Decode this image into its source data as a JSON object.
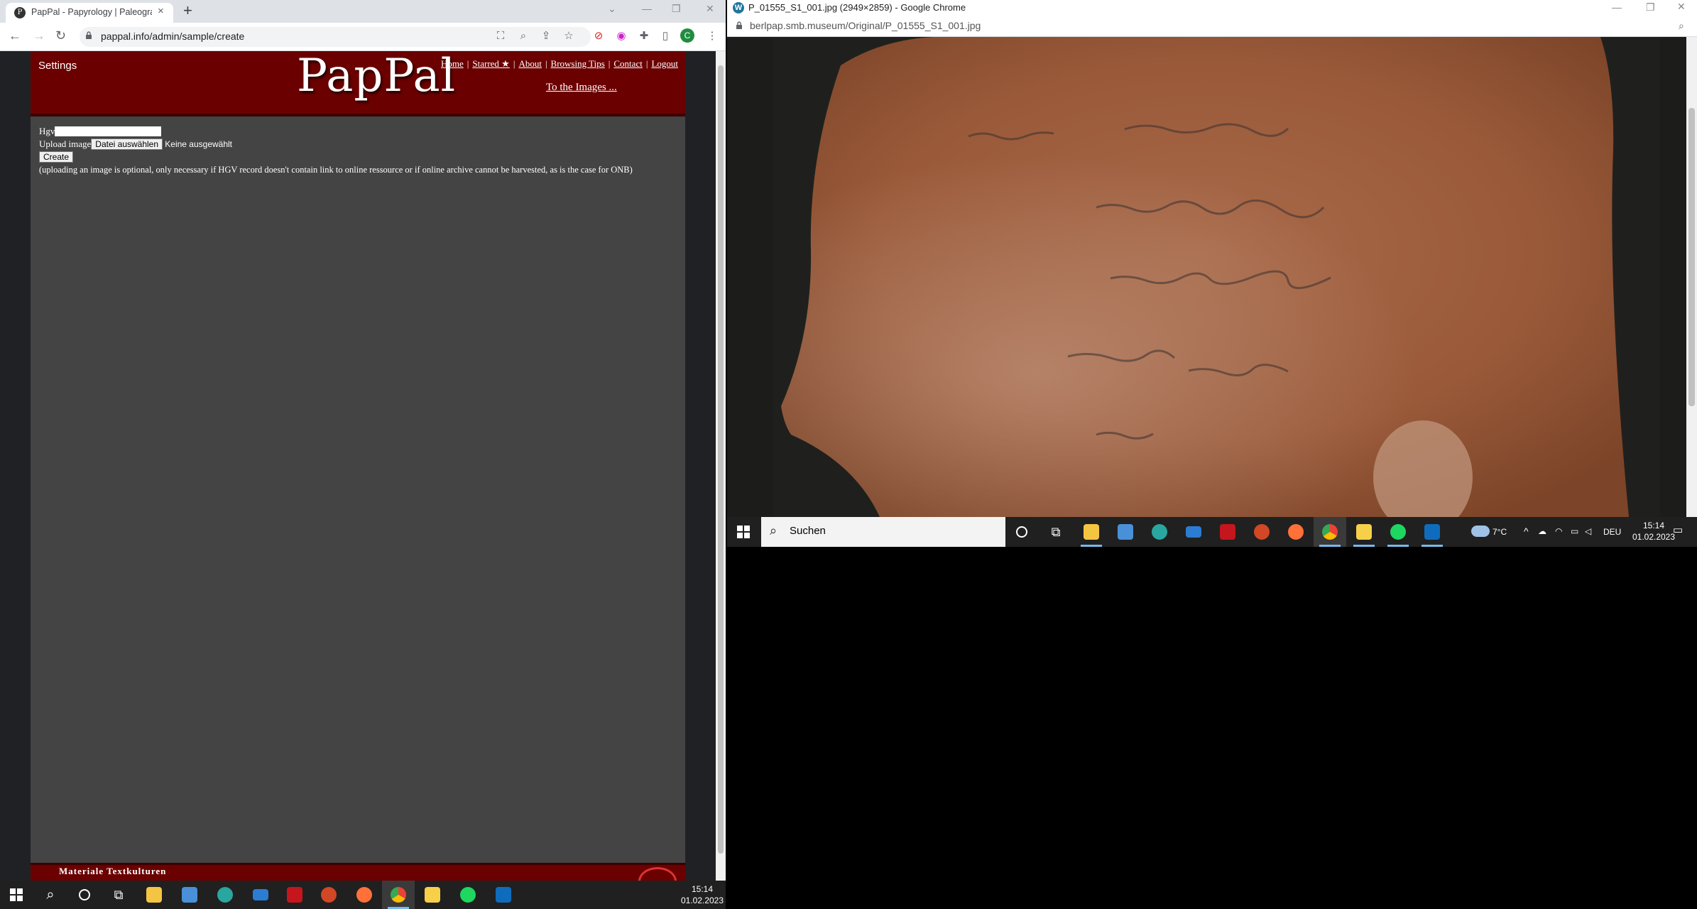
{
  "left_window": {
    "tab_title": "PapPal - Papyrology | Paleography",
    "url": "pappal.info/admin/sample/create",
    "site": {
      "settings_label": "Settings",
      "logo": "PapPal",
      "nav": [
        "Home",
        "Starred ★",
        "About",
        "Browsing Tips",
        "Contact",
        "Logout"
      ],
      "to_images": "To the Images ...",
      "footer_text": "Materiale Textkulturen"
    },
    "form": {
      "hgv_label": "Hgv",
      "hgv_value": "",
      "upload_label": "Upload image",
      "file_button": "Datei auswählen",
      "file_status": "Keine ausgewählt",
      "create_button": "Create",
      "note": "(uploading an image is optional, only necessary if HGV record doesn't contain link to online ressource or if online archive cannot be harvested, as is the case for ONB)"
    },
    "taskbar": {
      "time": "15:14",
      "date": "01.02.2023",
      "apps": [
        "start",
        "search",
        "cortana",
        "task-view",
        "file-explorer",
        "store",
        "edge",
        "mail",
        "acrobat",
        "powerpoint",
        "firefox",
        "chrome",
        "notes",
        "spotify",
        "photos"
      ],
      "active_app": "chrome"
    }
  },
  "right_window": {
    "title": "P_01555_S1_001.jpg (2949×2859) - Google Chrome",
    "url": "berlpap.smb.museum/Original/P_01555_S1_001.jpg",
    "taskbar": {
      "search_placeholder": "Suchen",
      "weather": "7°C",
      "language": "DEU",
      "time": "15:14",
      "date": "01.02.2023",
      "apps": [
        "cortana",
        "task-view",
        "file-explorer",
        "store",
        "edge",
        "mail",
        "acrobat",
        "powerpoint",
        "firefox",
        "chrome",
        "notes",
        "spotify",
        "photos"
      ]
    }
  },
  "colors": {
    "header_red": "#6b0000",
    "page_gray": "#444444",
    "sherd": "#9a5a3a"
  }
}
